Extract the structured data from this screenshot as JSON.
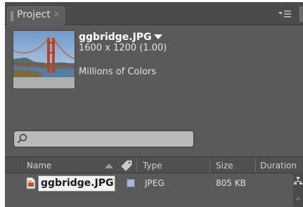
{
  "tab": {
    "label": "Project",
    "close": "×"
  },
  "preview": {
    "filename": "ggbridge.JPG",
    "dimensions": "1600 x 1200 (1.00)",
    "colors": "Millions of Colors"
  },
  "search": {
    "value": "",
    "placeholder": ""
  },
  "columns": {
    "name": "Name",
    "type": "Type",
    "size": "Size",
    "duration": "Duration"
  },
  "rows": [
    {
      "name": "ggbridge.JPG",
      "type": "JPEG",
      "size": "805 KB",
      "label_color": "#a8b4d8"
    }
  ],
  "icons": [
    "panel-menu-icon",
    "search-icon",
    "sort-arrow-icon",
    "label-tag-icon",
    "file-icon",
    "flowchart-icon"
  ]
}
